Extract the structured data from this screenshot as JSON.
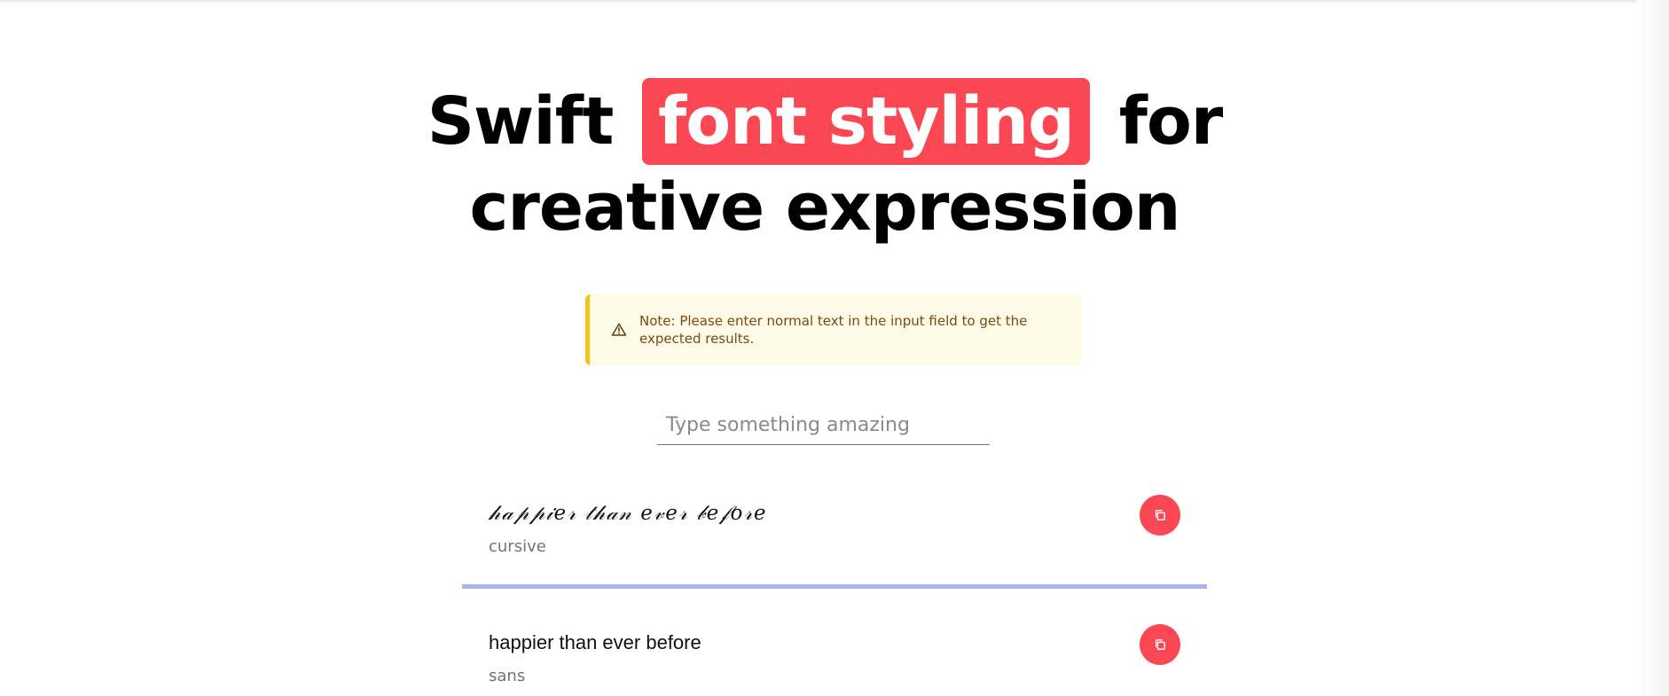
{
  "hero": {
    "before_highlight": "Swift",
    "highlight": "font styling",
    "after_highlight": "for",
    "line2": "creative expression"
  },
  "note": {
    "icon": "warning-triangle-icon",
    "text": "Note: Please enter normal text in the input field to get the expected results."
  },
  "input": {
    "value": "",
    "placeholder": "Type something amazing"
  },
  "results": [
    {
      "text": "𝒽𝒶𝓅𝓅𝒾𝑒𝓇 𝓉𝒽𝒶𝓃 𝑒𝓋𝑒𝓇 𝒷𝑒𝒻𝑜𝓇𝑒",
      "label": "cursive",
      "copy_icon": "copy-icon"
    },
    {
      "text": "happier than ever before",
      "label": "sans",
      "copy_icon": "copy-icon"
    }
  ],
  "colors": {
    "accent": "#fb4754",
    "note_bg": "#fefae8",
    "note_border": "#f5c21a",
    "note_text": "#7a4a12",
    "divider": "#a8b4ef",
    "label": "#6f7280"
  }
}
